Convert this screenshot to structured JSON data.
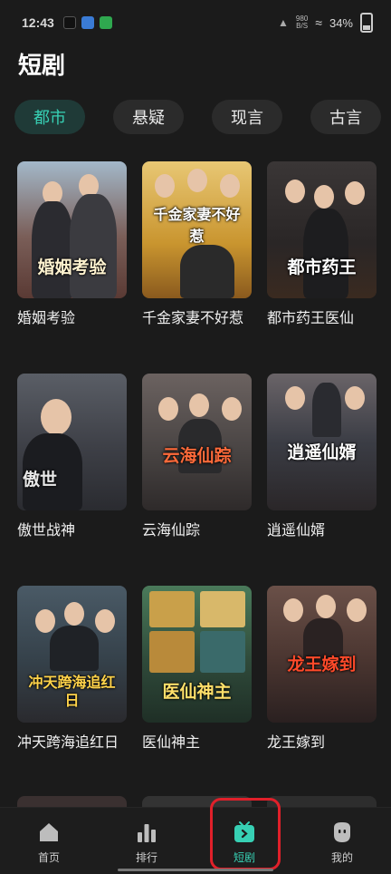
{
  "status_bar": {
    "time": "12:43",
    "net_speed_top": "980",
    "net_speed_bottom": "B/S",
    "battery": "34%"
  },
  "page_title": "短剧",
  "tabs": [
    {
      "label": "都市",
      "active": true
    },
    {
      "label": "悬疑",
      "active": false
    },
    {
      "label": "现言",
      "active": false
    },
    {
      "label": "古言",
      "active": false
    }
  ],
  "dramas": [
    {
      "title": "婚姻考验",
      "poster_text": "婚姻考验",
      "bg": "#8a6b62",
      "accent": "#d9c0a8"
    },
    {
      "title": "千金家妻不好惹",
      "poster_text": "千金家妻不好惹",
      "bg": "#c79a3a",
      "accent": "#f2d27a"
    },
    {
      "title": "都市药王医仙",
      "poster_text": "都市药王",
      "bg": "#2f2b2b",
      "accent": "#6a5a4a"
    },
    {
      "title": "傲世战神",
      "poster_text": "傲世",
      "bg": "#3d3f46",
      "accent": "#8a8f98"
    },
    {
      "title": "云海仙踪",
      "poster_text": "云海仙踪",
      "bg": "#4a4544",
      "accent": "#c45a3a"
    },
    {
      "title": "逍遥仙婿",
      "poster_text": "逍遥仙婿",
      "bg": "#3b3d45",
      "accent": "#9a8c84"
    },
    {
      "title": "冲天跨海追红日",
      "poster_text": "冲天跨海追红日",
      "bg": "#35414a",
      "accent": "#d8a63a"
    },
    {
      "title": "医仙神主",
      "poster_text": "医仙神主",
      "bg": "#2f4a3a",
      "accent": "#e0b64a"
    },
    {
      "title": "龙王嫁到",
      "poster_text": "龙王嫁到",
      "bg": "#4a3530",
      "accent": "#d24a2a"
    }
  ],
  "bottom_nav": [
    {
      "label": "首页",
      "icon": "home-icon",
      "active": false
    },
    {
      "label": "排行",
      "icon": "bar-chart-icon",
      "active": false
    },
    {
      "label": "短剧",
      "icon": "tv-play-icon",
      "active": true
    },
    {
      "label": "我的",
      "icon": "profile-icon",
      "active": false
    }
  ],
  "colors": {
    "accent": "#37d0b4",
    "background": "#1b1b1b",
    "highlight": "#e0202a"
  }
}
